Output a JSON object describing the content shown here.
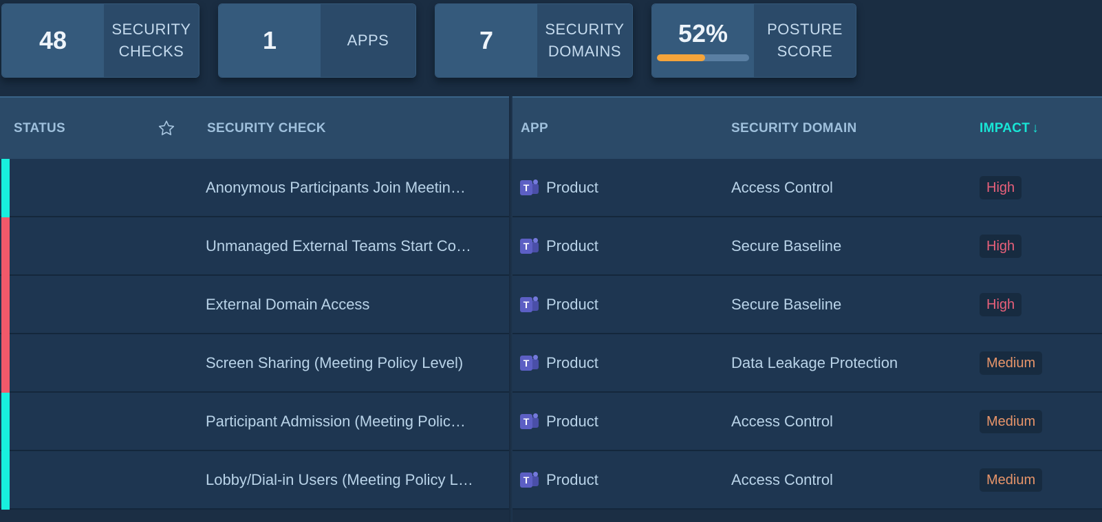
{
  "stats": [
    {
      "value": "48",
      "label_line1": "SECURITY",
      "label_line2": "CHECKS"
    },
    {
      "value": "1",
      "label_line1": "APPS",
      "label_line2": ""
    },
    {
      "value": "7",
      "label_line1": "SECURITY",
      "label_line2": "DOMAINS"
    },
    {
      "value": "52%",
      "label_line1": "POSTURE",
      "label_line2": "SCORE",
      "progress_percent": 52
    }
  ],
  "colors": {
    "status_pass": "#18f0de",
    "status_fail": "#f0596a",
    "impact_high": "#e8607a",
    "impact_medium": "#e8956a",
    "progress_fill": "#f5a43a",
    "active_header": "#18e6d6"
  },
  "table": {
    "headers": {
      "status": "STATUS",
      "star_icon": "star-outline-icon",
      "security_check": "SECURITY CHECK",
      "app": "APP",
      "security_domain": "SECURITY DOMAIN",
      "impact": "IMPACT",
      "impact_sort": "↓"
    },
    "rows": [
      {
        "status": "pass",
        "check": "Anonymous Participants Join Meetin…",
        "app_icon": "teams-icon",
        "app": "Product",
        "domain": "Access Control",
        "impact": "High"
      },
      {
        "status": "fail",
        "check": "Unmanaged External Teams Start Co…",
        "app_icon": "teams-icon",
        "app": "Product",
        "domain": "Secure Baseline",
        "impact": "High"
      },
      {
        "status": "fail",
        "check": "External Domain Access",
        "app_icon": "teams-icon",
        "app": "Product",
        "domain": "Secure Baseline",
        "impact": "High"
      },
      {
        "status": "fail",
        "check": "Screen Sharing (Meeting Policy Level)",
        "app_icon": "teams-icon",
        "app": "Product",
        "domain": "Data Leakage Protection",
        "impact": "Medium"
      },
      {
        "status": "pass",
        "check": "Participant Admission (Meeting Polic…",
        "app_icon": "teams-icon",
        "app": "Product",
        "domain": "Access Control",
        "impact": "Medium"
      },
      {
        "status": "pass",
        "check": "Lobby/Dial-in Users (Meeting Policy L…",
        "app_icon": "teams-icon",
        "app": "Product",
        "domain": "Access Control",
        "impact": "Medium"
      }
    ]
  }
}
